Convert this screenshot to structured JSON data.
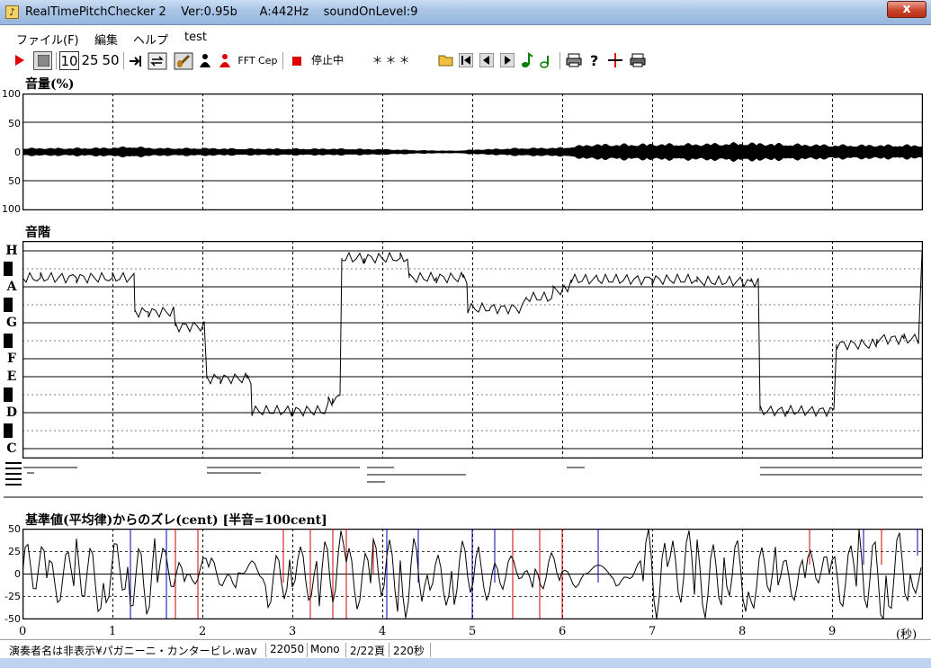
{
  "window": {
    "title": "RealTimePitchChecker 2    Ver:0.95b      A:442Hz    soundOnLevel:9",
    "close_glyph": "x"
  },
  "menu": {
    "file": "ファイル(F)",
    "edit": "編集",
    "help": "ヘルプ",
    "test": "test"
  },
  "toolbar": {
    "speed_10": "10",
    "speed_25": "25",
    "speed_50": "50",
    "fft": "FFT",
    "cep": "Cep",
    "status": "停止中",
    "note_display": "＊＊＊",
    "accent_color": "#ff0000",
    "icons": [
      "play-icon",
      "stop-icon",
      "jump-end-icon",
      "repeat-icon",
      "violin-icon",
      "person-icon",
      "person-red-icon",
      "stop-red-icon",
      "folder-open-icon",
      "skip-first-icon",
      "prev-icon",
      "next-icon",
      "note-green-icon",
      "note-green-small-icon",
      "print-icon",
      "help-icon",
      "marker-icon",
      "printer-icon"
    ]
  },
  "volume_panel": {
    "title": "音量(%)",
    "y_labels": [
      "100",
      "50",
      "0",
      "50",
      "100"
    ]
  },
  "scale_panel": {
    "title": "音階",
    "notes": [
      "H",
      "A",
      "G",
      "F",
      "E",
      "D",
      "C"
    ]
  },
  "deviation_panel": {
    "title": "基準値(平均律)からのズレ(cent) [半音=100cent]",
    "y_labels": [
      "50",
      "25",
      "0",
      "-25",
      "-50"
    ]
  },
  "x_axis": {
    "labels": [
      "0",
      "1",
      "2",
      "3",
      "4",
      "5",
      "6",
      "7",
      "8",
      "9"
    ],
    "unit": "(秒)"
  },
  "status_bar": {
    "file": "演奏者名は非表示¥パガニーニ・カンタービレ.wav",
    "rate": "22050",
    "channels": "Mono",
    "page": "2/22頁",
    "length": "220秒"
  },
  "chart_data": [
    {
      "type": "area",
      "title": "音量(%)",
      "xlabel": "(秒)",
      "xlim": [
        0,
        10
      ],
      "ylim": [
        -100,
        100
      ],
      "x_ticks": [
        0,
        1,
        2,
        3,
        4,
        5,
        6,
        7,
        8,
        9
      ],
      "y_ticks": [
        "100",
        "50",
        "0",
        "50",
        "100"
      ],
      "series": [
        {
          "x": [
            0,
            0.5,
            1,
            1.2,
            1.5,
            2,
            2.5,
            3,
            3.5,
            4,
            4.4,
            4.8,
            5,
            5.5,
            6,
            6.3,
            7,
            7.5,
            8,
            8.5,
            9,
            9.5,
            10
          ],
          "values": [
            7,
            7,
            8,
            10,
            7,
            7,
            6,
            6,
            6,
            5,
            3,
            2,
            4,
            7,
            8,
            14,
            15,
            15,
            17,
            15,
            13,
            13,
            13
          ]
        }
      ]
    },
    {
      "type": "line",
      "title": "音階",
      "xlabel": "(秒)",
      "xlim": [
        0,
        10
      ],
      "categories": [
        "C",
        "D",
        "E",
        "F",
        "G",
        "A",
        "H"
      ],
      "series": [
        {
          "x": [
            0,
            0.2,
            0.4,
            0.6,
            0.8,
            1,
            1.2,
            1.25,
            1.4,
            1.6,
            1.7,
            2.05,
            2.2,
            2.5,
            2.55,
            3,
            3.2,
            3.4,
            3.45,
            3.55,
            3.8,
            4.2,
            4.3,
            4.6,
            4.9,
            4.95,
            5.2,
            5.6,
            5.9,
            6.1,
            6.4,
            7,
            7.5,
            8.1,
            8.2,
            8.5,
            9.05,
            9.5,
            9.8,
            10
          ],
          "values": [
            9.5,
            9.5,
            9.5,
            9.5,
            9.5,
            9.5,
            9.5,
            7.6,
            7.6,
            7.6,
            6.8,
            3.9,
            3.9,
            3.9,
            2.1,
            2.1,
            2.1,
            2.6,
            2.8,
            10.6,
            10.6,
            10.6,
            9.5,
            9.5,
            9.5,
            7.8,
            7.8,
            8.4,
            8.8,
            9.4,
            9.4,
            9.4,
            9.3,
            9.3,
            2.1,
            2.1,
            5.8,
            6.1,
            6.1,
            10.9
          ]
        }
      ]
    },
    {
      "type": "line",
      "title": "基準値(平均律)からのズレ(cent) [半音=100cent]",
      "xlabel": "(秒)",
      "xlim": [
        0,
        10
      ],
      "ylim": [
        -50,
        50
      ],
      "y_ticks": [
        50,
        25,
        0,
        -25,
        -50
      ],
      "series": [
        {
          "x": [
            0,
            0.3,
            0.6,
            0.9,
            1.2,
            1.5,
            1.8,
            2.1,
            2.4,
            2.7,
            3,
            3.3,
            3.6,
            3.9,
            4.2,
            4.5,
            4.8,
            5.1,
            5.4,
            5.7,
            6,
            6.3,
            6.6,
            6.9,
            7.2,
            7.5,
            7.8,
            8.1,
            8.4,
            8.7,
            9,
            9.3,
            9.6,
            9.9
          ],
          "values": [
            30,
            -25,
            35,
            -30,
            40,
            -20,
            10,
            -10,
            5,
            -30,
            25,
            -40,
            30,
            -35,
            40,
            -25,
            30,
            20,
            10,
            -15,
            -5,
            0,
            5,
            -45,
            40,
            -40,
            35,
            -30,
            20,
            -20,
            30,
            -45,
            40,
            -20
          ]
        }
      ]
    }
  ]
}
